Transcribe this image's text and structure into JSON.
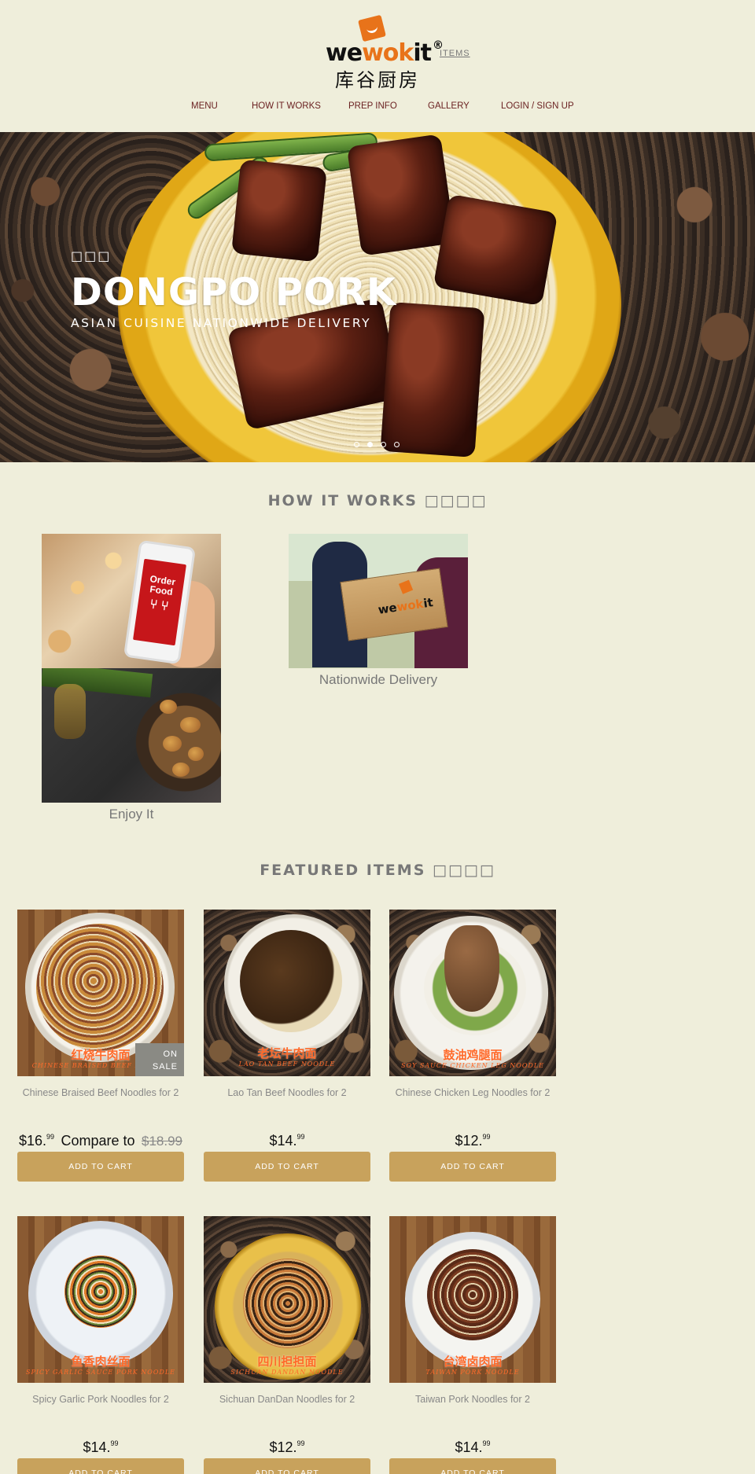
{
  "header": {
    "logo_word_prefix": "we",
    "logo_word_mid": "wok",
    "logo_word_suffix": "it",
    "logo_registered": "®",
    "logo_chinese": "库谷厨房",
    "items_link": "ITEMS"
  },
  "nav": {
    "items": [
      {
        "label": "MENU"
      },
      {
        "label": "HOW IT WORKS"
      },
      {
        "label": "PREP INFO"
      },
      {
        "label": "GALLERY"
      },
      {
        "label": "LOGIN / SIGN UP"
      }
    ]
  },
  "hero": {
    "small_text": "□□□",
    "title": "DONGPO PORK",
    "subtitle": "ASIAN CUISINE NATIONWIDE DELIVERY",
    "slide_count": 4,
    "active_slide": 2
  },
  "how_it_works": {
    "title": "HOW IT WORKS □□□□",
    "order_phone_text_1": "Order",
    "order_phone_text_2": "Food",
    "box_logo_prefix": "we",
    "box_logo_mid": "wok",
    "box_logo_suffix": "it",
    "steps": [
      {
        "caption": "Enjoy It"
      },
      {
        "caption": "Nationwide Delivery"
      }
    ]
  },
  "featured": {
    "title": "FEATURED ITEMS □□□□",
    "add_to_cart_label": "ADD TO CART",
    "sale_badge_line1": "ON",
    "sale_badge_line2": "SALE",
    "compare_label": "Compare to",
    "products": [
      {
        "name": "Chinese Braised Beef Noodles for 2",
        "cn": "红烧牛肉面",
        "en": "CHINESE BRAISED BEEF NOODLE",
        "price_dollars": "$16.",
        "price_cents": "99",
        "compare_price": "$18.99",
        "on_sale": true
      },
      {
        "name": "Lao Tan Beef Noodles for 2",
        "cn": "老坛牛肉面",
        "en": "LAO TAN BEEF NOODLE",
        "price_dollars": "$14.",
        "price_cents": "99"
      },
      {
        "name": "Chinese Chicken Leg Noodles for 2",
        "cn": "鼓油鸡腿面",
        "en": "SOY SAUCE CHICKEN LEG NOODLE",
        "price_dollars": "$12.",
        "price_cents": "99"
      },
      {
        "name": "Spicy Garlic Pork Noodles for 2",
        "cn": "鱼香肉丝面",
        "en": "SPICY GARLIC SAUCE PORK NOODLE",
        "price_dollars": "$14.",
        "price_cents": "99"
      },
      {
        "name": "Sichuan DanDan Noodles for 2",
        "cn": "四川担担面",
        "en": "SICHUAN DANDAN NOODLE",
        "price_dollars": "$12.",
        "price_cents": "99"
      },
      {
        "name": "Taiwan Pork Noodles for 2",
        "cn": "台湾卤肉面",
        "en": "TAIWAN PORK NOODLE",
        "price_dollars": "$14.",
        "price_cents": "99"
      }
    ]
  },
  "colors": {
    "page_bg": "#efeedb",
    "nav_text": "#6b2222",
    "brand_orange": "#e8731a",
    "button_bg": "#c8a25c",
    "sale_badge_bg": "#8a8a84"
  }
}
